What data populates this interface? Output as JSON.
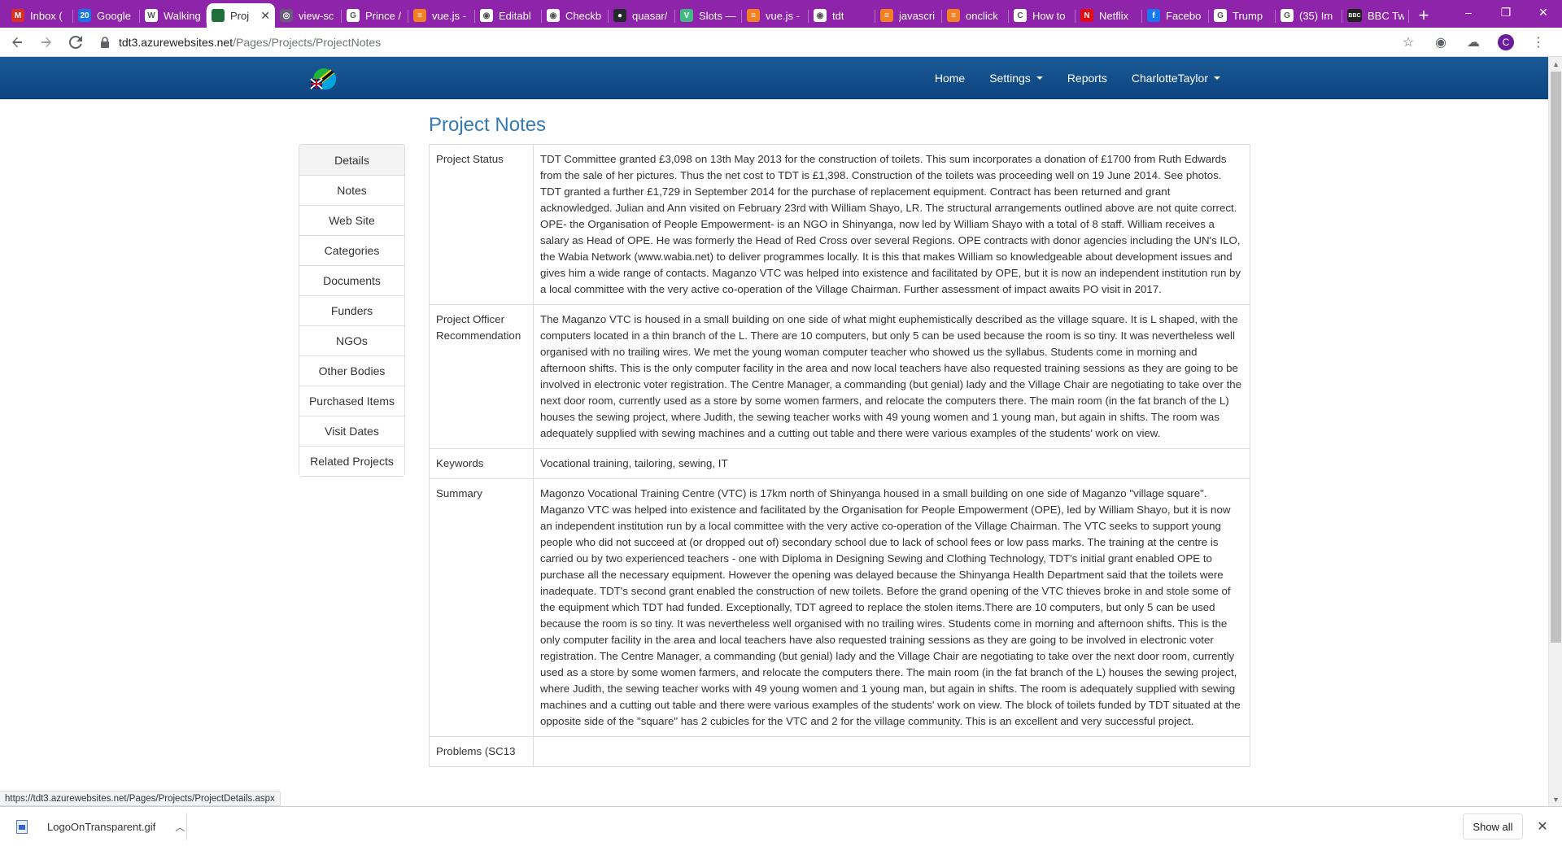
{
  "browser": {
    "tabs": [
      {
        "title": "Inbox (",
        "icon": "gmail-icon",
        "color": "#d93025",
        "glyph": "M"
      },
      {
        "title": "Google",
        "icon": "google-calendar-icon",
        "color": "#1a73e8",
        "glyph": "20"
      },
      {
        "title": "Walking",
        "icon": "wikipedia-icon",
        "color": "#ffffff",
        "glyph": "W"
      },
      {
        "title": "Proj",
        "icon": "tdt-logo-icon",
        "color": "#1f6f3a",
        "glyph": "",
        "active": true
      },
      {
        "title": "view-sc",
        "icon": "globe-icon",
        "color": "#6b5b7b",
        "glyph": "◎"
      },
      {
        "title": "Prince /",
        "icon": "g-icon",
        "color": "#ffffff",
        "glyph": "G"
      },
      {
        "title": "vue.js -",
        "icon": "stackoverflow-icon",
        "color": "#f48024",
        "glyph": "≡"
      },
      {
        "title": "Editabl",
        "icon": "chrome-icon",
        "color": "#ffffff",
        "glyph": "◉"
      },
      {
        "title": "Checkb",
        "icon": "chrome-icon",
        "color": "#ffffff",
        "glyph": "◉"
      },
      {
        "title": "quasar/",
        "icon": "github-icon",
        "color": "#24292e",
        "glyph": "●"
      },
      {
        "title": "Slots —",
        "icon": "vue-icon",
        "color": "#42b883",
        "glyph": "V"
      },
      {
        "title": "vue.js -",
        "icon": "stackoverflow-icon",
        "color": "#f48024",
        "glyph": "≡"
      },
      {
        "title": "tdt",
        "icon": "chrome-icon",
        "color": "#ffffff",
        "glyph": "◉"
      },
      {
        "title": "javascri",
        "icon": "stackoverflow-icon",
        "color": "#f48024",
        "glyph": "≡"
      },
      {
        "title": "onclick",
        "icon": "stackoverflow-icon",
        "color": "#f48024",
        "glyph": "≡"
      },
      {
        "title": "How to",
        "icon": "c-icon",
        "color": "#ffffff",
        "glyph": "C"
      },
      {
        "title": "Netflix",
        "icon": "netflix-icon",
        "color": "#e50914",
        "glyph": "N"
      },
      {
        "title": "Facebo",
        "icon": "facebook-icon",
        "color": "#1877f2",
        "glyph": "f"
      },
      {
        "title": "Trump",
        "icon": "g-icon",
        "color": "#ffffff",
        "glyph": "G"
      },
      {
        "title": "(35) Im",
        "icon": "g-icon",
        "color": "#ffffff",
        "glyph": "G"
      },
      {
        "title": "BBC Tw",
        "icon": "bbc-icon",
        "color": "#222222",
        "glyph": "BBC"
      }
    ],
    "new_tab": "+",
    "window_controls": {
      "minimize": "–",
      "restore": "❐",
      "close": "✕"
    },
    "url_host": "tdt3.azurewebsites.net",
    "url_path": "/Pages/Projects/ProjectNotes",
    "profile_initial": "C",
    "status_url": "https://tdt3.azurewebsites.net/Pages/Projects/ProjectDetails.aspx"
  },
  "site_nav": {
    "items": [
      {
        "label": "Home",
        "dropdown": false
      },
      {
        "label": "Settings",
        "dropdown": true
      },
      {
        "label": "Reports",
        "dropdown": false
      },
      {
        "label": "CharlotteTaylor",
        "dropdown": true
      }
    ]
  },
  "page": {
    "title": "Project Notes",
    "sidenav": [
      {
        "label": "Details",
        "active": true
      },
      {
        "label": "Notes"
      },
      {
        "label": "Web Site"
      },
      {
        "label": "Categories"
      },
      {
        "label": "Documents"
      },
      {
        "label": "Funders"
      },
      {
        "label": "NGOs"
      },
      {
        "label": "Other Bodies"
      },
      {
        "label": "Purchased Items"
      },
      {
        "label": "Visit Dates"
      },
      {
        "label": "Related Projects"
      }
    ],
    "notes": [
      {
        "label": "Project Status",
        "value": "TDT Committee granted £3,098 on 13th May 2013 for the construction of toilets. This sum incorporates a donation of £1700 from Ruth Edwards from the sale of her pictures. Thus the net cost to TDT is £1,398. Construction of the toilets was proceeding well on 19 June 2014. See photos. TDT granted a further £1,729 in September 2014 for the purchase of replacement equipment. Contract has been returned and grant acknowledged. Julian and Ann visited on February 23rd with William Shayo, LR. The structural arrangements outlined above are not quite correct. OPE- the Organisation of People Empowerment- is an NGO in Shinyanga, now led by William Shayo with a total of 8 staff. William receives a salary as Head of OPE. He was formerly the Head of Red Cross over several Regions. OPE contracts with donor agencies including the UN's ILO, the Wabia Network (www.wabia.net) to deliver programmes locally. It is this that makes William so knowledgeable about development issues and gives him a wide range of contacts. Maganzo VTC was helped into existence and facilitated by OPE, but it is now an independent institution run by a local committee with the very active co-operation of the Village Chairman. Further assessment of impact awaits PO visit in 2017."
      },
      {
        "label": "Project Officer Recommendation",
        "value": "The Maganzo VTC is housed in a small building on one side of what might euphemistically described as the village square. It is L shaped, with the computers located in a thin branch of the L. There are 10 computers, but only 5 can be used because the room is so tiny. It was nevertheless well organised with no trailing wires. We met the young woman computer teacher who showed us the syllabus. Students come in morning and afternoon shifts. This is the only computer facility in the area and now local teachers have also requested training sessions as they are going to be involved in electronic voter registration. The Centre Manager, a commanding (but genial) lady and the Village Chair are negotiating to take over the next door room, currently used as a store by some women farmers, and relocate the computers there. The main room (in the fat branch of the L) houses the sewing project, where Judith, the sewing teacher works with 49 young women and 1 young man, but again in shifts. The room was adequately supplied with sewing machines and a cutting out table and there were various examples of the students' work on view."
      },
      {
        "label": "Keywords",
        "value": "Vocational training, tailoring, sewing, IT"
      },
      {
        "label": "Summary",
        "value": "Magonzo Vocational Training Centre (VTC) is 17km north of Shinyanga housed in a small building on one side of Maganzo \"village square\". Maganzo VTC was helped into existence and facilitated by the Organisation for People Empowerment (OPE), led by William Shayo, but it is now an independent institution run by a local committee with the very active co-operation of the Village Chairman. The VTC seeks to support young people who did not succeed at (or dropped out of) secondary school due to lack of school fees or low pass marks. The training at the centre is carried ou by two experienced teachers - one with Diploma in Designing Sewing and Clothing Technology, TDT's initial grant enabled OPE to purchase all the necessary equipment. However the opening was delayed because the Shinyanga Health Department said that the toilets were inadequate. TDT's second grant enabled the construction of new toilets. Before the grand opening of the VTC thieves broke in and stole some of the equipment which TDT had funded. Exceptionally, TDT agreed to replace the stolen items.There are 10 computers, but only 5 can be used because the room is so tiny. It was nevertheless well organised with no trailing wires. Students come in morning and afternoon shifts. This is the only computer facility in the area and local teachers have also requested training sessions as they are going to be involved in electronic voter registration. The Centre Manager, a commanding (but genial) lady and the Village Chair are negotiating to take over the next door room, currently used as a store by some women farmers, and relocate the computers there. The main room (in the fat branch of the L) houses the sewing project, where Judith, the sewing teacher works with 49 young women and 1 young man, but again in shifts. The room is adequately supplied with sewing machines and a cutting out table and there were various examples of the students' work on view. The block of toilets funded by TDT situated at the opposite side of the \"square\" has 2 cubicles for the VTC and 2 for the village community. This is an excellent and very successful project."
      },
      {
        "label": "Problems (SC13",
        "value": ""
      }
    ]
  },
  "downloads": {
    "file_name": "LogoOnTransparent.gif",
    "show_all": "Show all",
    "close": "✕"
  },
  "colors": {
    "tab_strip": "#8e24aa",
    "site_nav": "#0d4480",
    "title": "#337ab7"
  }
}
